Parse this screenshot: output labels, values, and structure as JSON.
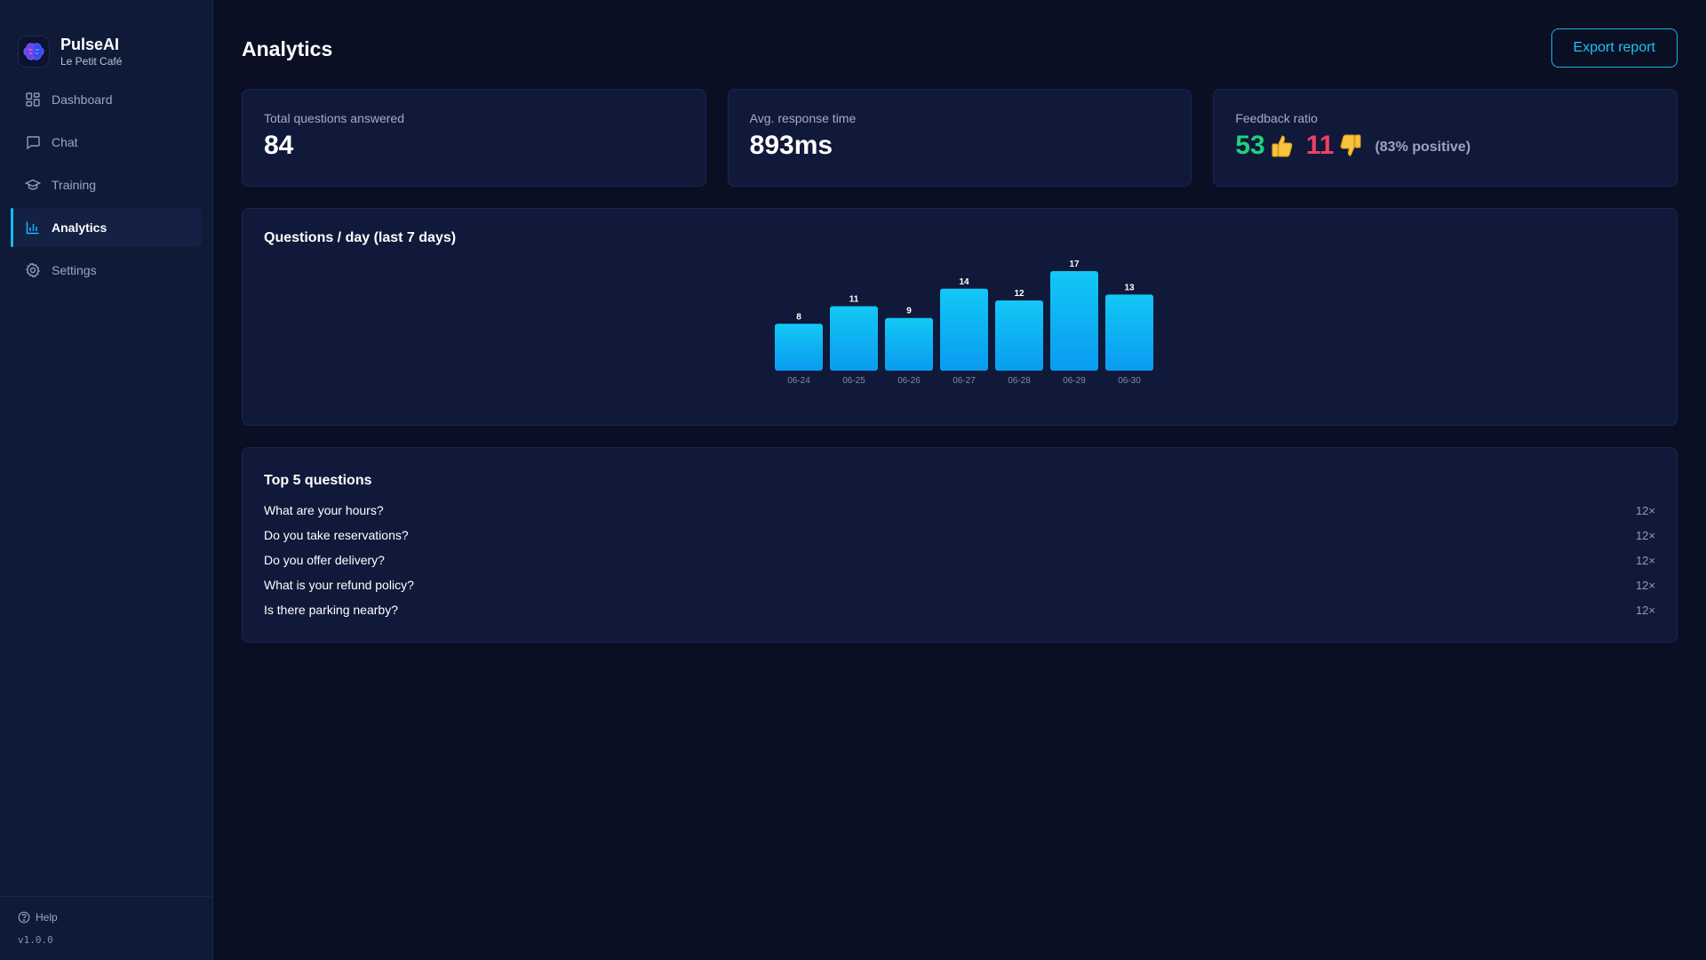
{
  "brand": {
    "name": "PulseAI",
    "subtitle": "Le Petit Café"
  },
  "nav": {
    "items": [
      {
        "label": "Dashboard",
        "icon": "dashboard-icon",
        "active": false
      },
      {
        "label": "Chat",
        "icon": "chat-icon",
        "active": false
      },
      {
        "label": "Training",
        "icon": "graduation-cap-icon",
        "active": false
      },
      {
        "label": "Analytics",
        "icon": "bar-chart-icon",
        "active": true
      },
      {
        "label": "Settings",
        "icon": "gear-icon",
        "active": false
      }
    ]
  },
  "footer": {
    "help_label": "Help",
    "version": "v1.0.0"
  },
  "header": {
    "title": "Analytics",
    "export_label": "Export report"
  },
  "stats": {
    "total": {
      "label": "Total questions answered",
      "value": "84"
    },
    "response": {
      "label": "Avg. response time",
      "value": "893ms"
    },
    "feedback": {
      "label": "Feedback ratio",
      "positive": "53",
      "negative": "11",
      "percent_text": "(83% positive)"
    }
  },
  "chart": {
    "title": "Questions / day (last 7 days)"
  },
  "chart_data": {
    "type": "bar",
    "title": "Questions / day (last 7 days)",
    "categories": [
      "06-24",
      "06-25",
      "06-26",
      "06-27",
      "06-28",
      "06-29",
      "06-30"
    ],
    "values": [
      8,
      11,
      9,
      14,
      12,
      17,
      13
    ],
    "xlabel": "",
    "ylabel": "",
    "ylim": [
      0,
      17
    ],
    "grid": false,
    "show_data_labels": true,
    "colors": {
      "bar_top": "#12c8f5",
      "bar_bottom": "#0a9bf0"
    }
  },
  "top_questions": {
    "title": "Top 5 questions",
    "items": [
      {
        "question": "What are your hours?",
        "count": "12×"
      },
      {
        "question": "Do you take reservations?",
        "count": "12×"
      },
      {
        "question": "Do you offer delivery?",
        "count": "12×"
      },
      {
        "question": "What is your refund policy?",
        "count": "12×"
      },
      {
        "question": "Is there parking nearby?",
        "count": "12×"
      }
    ]
  },
  "colors": {
    "accent": "#16b8f3",
    "positive": "#22d07a",
    "negative": "#ee4065",
    "background": "#0a0f24",
    "card": "#10193a"
  }
}
